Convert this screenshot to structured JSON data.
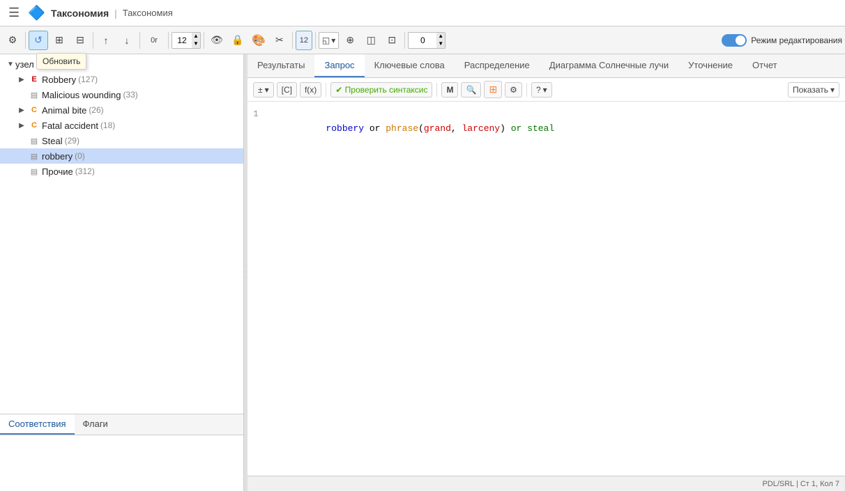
{
  "titleBar": {
    "appIcon": "🔷",
    "appName": "Таксономия",
    "separator": "|",
    "docName": "Таксономия",
    "hamburgerLabel": "☰"
  },
  "toolbar": {
    "buttons": [
      {
        "id": "settings",
        "icon": "⚙",
        "label": "Настройки"
      },
      {
        "id": "refresh",
        "icon": "↺",
        "label": "Обновить",
        "tooltip": true
      },
      {
        "id": "add-node",
        "icon": "⊞",
        "label": "Добавить узел"
      },
      {
        "id": "remove-node",
        "icon": "⊟",
        "label": "Удалить узел"
      },
      {
        "id": "up",
        "icon": "↑",
        "label": "Вверх"
      },
      {
        "id": "down",
        "icon": "↓",
        "label": "Вниз"
      },
      {
        "id": "0r",
        "icon": "0r",
        "label": "0r"
      }
    ],
    "numberInput": "12",
    "eyeBtn": "👁",
    "lockBtn": "🔒",
    "colorBtn": "🎨",
    "cutBtn": "✂",
    "numBadge": "12",
    "dropdown1": "◱",
    "dropdown2": "⊕",
    "dropdown3": "◫",
    "dropdown4": "⊡",
    "zeroValue": "0",
    "toggleLabel": "Режим редактирования"
  },
  "tooltip": {
    "text": "Обновить"
  },
  "tree": {
    "rootLabel": "узел (535)",
    "rootExpanded": true,
    "items": [
      {
        "id": "robbery",
        "type": "E",
        "label": "Robbery",
        "count": "(127)",
        "expanded": false,
        "indent": 1
      },
      {
        "id": "malicious-wounding",
        "type": "doc",
        "label": "Malicious wounding",
        "count": "(33)",
        "indent": 1
      },
      {
        "id": "animal-bite",
        "type": "C",
        "label": "Animal bite",
        "count": "(26)",
        "expanded": false,
        "indent": 1
      },
      {
        "id": "fatal-accident",
        "type": "C",
        "label": "Fatal accident",
        "count": "(18)",
        "expanded": false,
        "indent": 1
      },
      {
        "id": "steal",
        "type": "doc",
        "label": "Steal",
        "count": "(29)",
        "indent": 1
      },
      {
        "id": "robbery-node",
        "type": "doc",
        "label": "robbery",
        "count": "(0)",
        "indent": 1,
        "selected": true
      },
      {
        "id": "prochie",
        "type": "doc",
        "label": "Прочие",
        "count": "(312)",
        "indent": 1
      }
    ]
  },
  "bottomTabs": [
    {
      "id": "matches",
      "label": "Соответствия",
      "active": true
    },
    {
      "id": "flags",
      "label": "Флаги",
      "active": false
    }
  ],
  "tabs": [
    {
      "id": "results",
      "label": "Результаты",
      "active": false
    },
    {
      "id": "query",
      "label": "Запрос",
      "active": true
    },
    {
      "id": "keywords",
      "label": "Ключевые слова",
      "active": false
    },
    {
      "id": "distribution",
      "label": "Распределение",
      "active": false
    },
    {
      "id": "sunburst",
      "label": "Диаграмма Солнечные лучи",
      "active": false
    },
    {
      "id": "refinement",
      "label": "Уточнение",
      "active": false
    },
    {
      "id": "report",
      "label": "Отчет",
      "active": false
    }
  ],
  "editorToolbar": {
    "insertBtn": "±",
    "insertDropdown": "▾",
    "bracketBtn": "[С]",
    "funcBtn": "f(x)",
    "checkBtn": "✔ Проверить синтаксис",
    "mBtn": "M",
    "searchBtn": "🔍",
    "gridBtn": "⊞",
    "settingsBtn": "⚙",
    "helpBtn": "?",
    "helpDropdown": "▾",
    "showBtn": "Показать",
    "showDropdown": "▾"
  },
  "editor": {
    "lineNumber": "1",
    "code": [
      {
        "type": "keyword-blue",
        "text": "robbery"
      },
      {
        "type": "operator",
        "text": " or "
      },
      {
        "type": "keyword-orange",
        "text": "phrase"
      },
      {
        "type": "plain",
        "text": "("
      },
      {
        "type": "keyword-red",
        "text": "grand"
      },
      {
        "type": "plain",
        "text": ", "
      },
      {
        "type": "keyword-red",
        "text": "larceny"
      },
      {
        "type": "plain",
        "text": ") "
      },
      {
        "type": "operator",
        "text": "or"
      },
      {
        "type": "plain",
        "text": " "
      },
      {
        "type": "keyword-green",
        "text": "steal"
      }
    ]
  },
  "statusBar": {
    "text": "PDL/SRL | Ст 1, Кол 7"
  }
}
